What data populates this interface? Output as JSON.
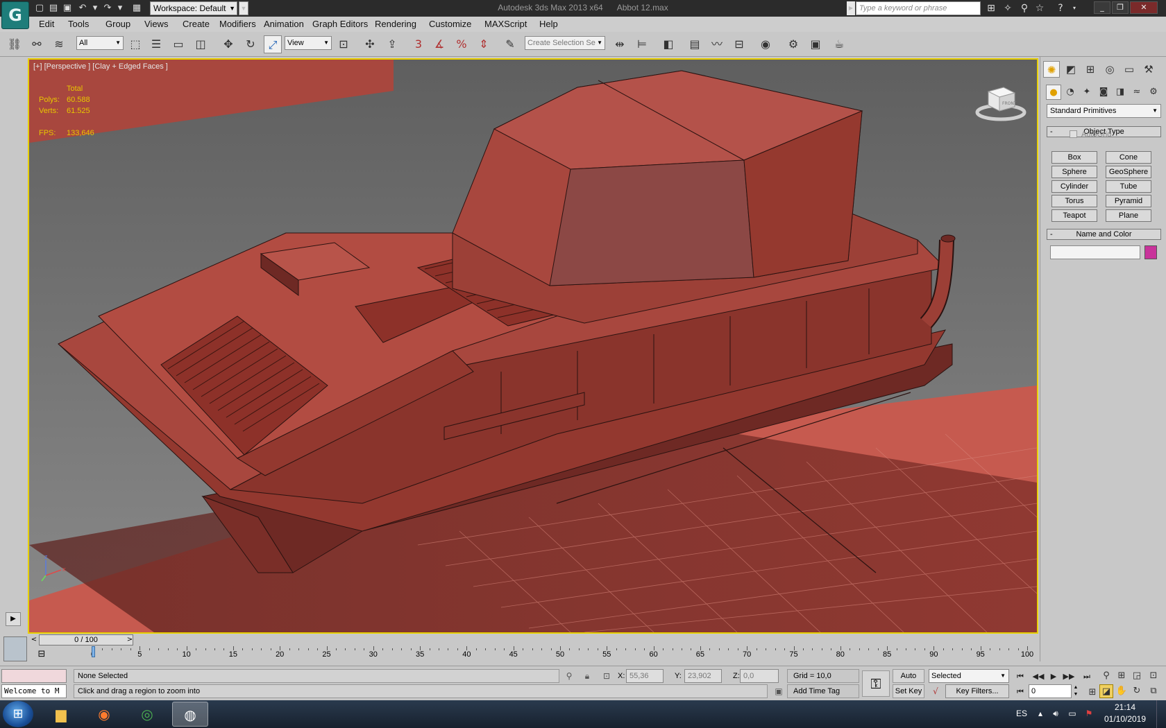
{
  "titlebar": {
    "app_title": "Autodesk 3ds Max  2013 x64",
    "file_name": "Abbot 12.max",
    "workspace": "Workspace: Default",
    "search_placeholder": "Type a keyword or phrase",
    "app_logo_glyph": "G"
  },
  "menu": [
    "Edit",
    "Tools",
    "Group",
    "Views",
    "Create",
    "Modifiers",
    "Animation",
    "Graph Editors",
    "Rendering",
    "Customize",
    "MAXScript",
    "Help"
  ],
  "toolbar": {
    "filter_value": "All",
    "ref_coord_value": "View",
    "snap_label": "3",
    "named_selection_placeholder": "Create Selection Se"
  },
  "viewport": {
    "label": "[+] [Perspective ] [Clay + Edged Faces ]",
    "stats": {
      "header": "Total",
      "polys_label": "Polys:",
      "polys_value": "60.588",
      "verts_label": "Verts:",
      "verts_value": "61.525",
      "fps_label": "FPS:",
      "fps_value": "133,646"
    },
    "viewcube_label": "FRONT",
    "axis_z": "z",
    "axis_x": "x",
    "colors": {
      "model": "#a8473e",
      "background": "#7a7a7a",
      "border": "#e8d000"
    }
  },
  "command_panel": {
    "category": "Standard Primitives",
    "object_type_title": "Object Type",
    "autogrid_label": "AutoGrid",
    "primitives": [
      "Box",
      "Cone",
      "Sphere",
      "GeoSphere",
      "Cylinder",
      "Tube",
      "Torus",
      "Pyramid",
      "Teapot",
      "Plane"
    ],
    "name_color_title": "Name and Color",
    "name_value": "",
    "object_color": "#c8339a"
  },
  "time_slider": {
    "position_label": "0 / 100",
    "left_arrow": "<",
    "right_arrow": ">"
  },
  "trackbar": {
    "labels": [
      "0",
      "5",
      "10",
      "15",
      "20",
      "25",
      "30",
      "35",
      "40",
      "45",
      "50",
      "55",
      "60",
      "65",
      "70",
      "75",
      "80",
      "85",
      "90",
      "95",
      "100"
    ]
  },
  "status": {
    "maxscript_text": "Welcome to M",
    "selection": "None Selected",
    "prompt": "Click and drag a region to zoom into",
    "x_label": "X:",
    "x_value": "55,36",
    "y_label": "Y:",
    "y_value": "23,902",
    "z_label": "Z:",
    "z_value": "0,0",
    "grid": "Grid = 10,0",
    "add_time_tag": "Add Time Tag",
    "auto_key": "Auto Key",
    "set_key": "Set Key",
    "key_mode": "Selected",
    "key_filters": "Key Filters...",
    "current_frame": "0"
  },
  "taskbar": {
    "language": "ES",
    "time": "21:14",
    "date": "01/10/2019"
  }
}
